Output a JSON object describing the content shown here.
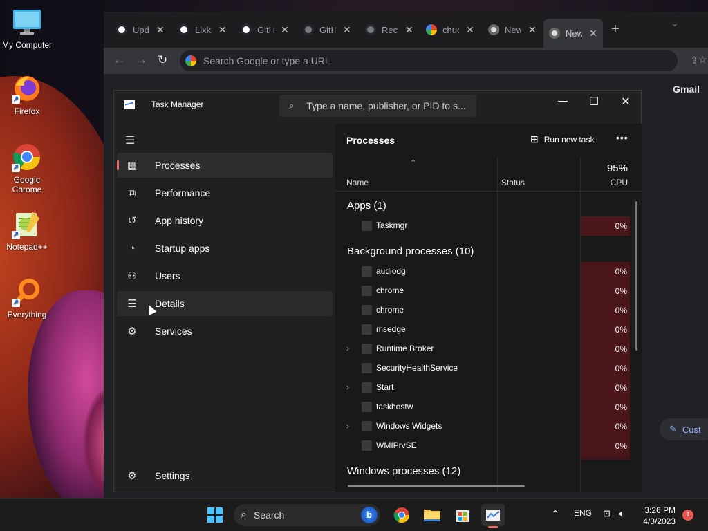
{
  "desktop": {
    "icons": [
      {
        "label": "My Computer",
        "icon": "monitor-icon"
      },
      {
        "label": "Firefox",
        "icon": "firefox-icon"
      },
      {
        "label": "Google Chrome",
        "icon": "chrome-icon"
      },
      {
        "label": "Notepad++",
        "icon": "notepadpp-icon"
      },
      {
        "label": "Everything",
        "icon": "everything-icon"
      }
    ]
  },
  "browser": {
    "tabs": [
      {
        "title": "Upd",
        "icon": "github-icon"
      },
      {
        "title": "Lixk",
        "icon": "github-icon"
      },
      {
        "title": "GitH",
        "icon": "github-icon"
      },
      {
        "title": "GitH",
        "icon": "github-icon"
      },
      {
        "title": "Rect",
        "icon": "github-icon"
      },
      {
        "title": "chuc",
        "icon": "google-icon"
      },
      {
        "title": "New",
        "icon": "chrome-icon"
      },
      {
        "title": "New",
        "icon": "chrome-icon"
      }
    ],
    "omnibox_placeholder": "Search Google or type a URL",
    "gmail_link": "Gmail",
    "customize_label": "Cust"
  },
  "task_manager": {
    "title": "Task Manager",
    "search_placeholder": "Type a name, publisher, or PID to s...",
    "nav": [
      {
        "label": "Processes",
        "icon": "processes-icon"
      },
      {
        "label": "Performance",
        "icon": "performance-icon"
      },
      {
        "label": "App history",
        "icon": "history-icon"
      },
      {
        "label": "Startup apps",
        "icon": "startup-icon"
      },
      {
        "label": "Users",
        "icon": "users-icon"
      },
      {
        "label": "Details",
        "icon": "list-icon"
      },
      {
        "label": "Services",
        "icon": "services-icon"
      }
    ],
    "settings_label": "Settings",
    "page_title": "Processes",
    "run_new_task": "Run new task",
    "columns": {
      "name": "Name",
      "status": "Status",
      "cpu_label": "CPU",
      "cpu_total": "95%"
    },
    "groups": {
      "apps": "Apps (1)",
      "background": "Background processes (10)",
      "windows": "Windows processes (12)"
    },
    "apps": [
      {
        "name": "Taskmgr",
        "cpu": "0%",
        "expandable": false
      }
    ],
    "background": [
      {
        "name": "audiodg",
        "cpu": "0%",
        "expandable": false
      },
      {
        "name": "chrome",
        "cpu": "0%",
        "expandable": false
      },
      {
        "name": "chrome",
        "cpu": "0%",
        "expandable": false
      },
      {
        "name": "msedge",
        "cpu": "0%",
        "expandable": false
      },
      {
        "name": "Runtime Broker",
        "cpu": "0%",
        "expandable": true
      },
      {
        "name": "SecurityHealthService",
        "cpu": "0%",
        "expandable": false
      },
      {
        "name": "Start",
        "cpu": "0%",
        "expandable": true
      },
      {
        "name": "taskhostw",
        "cpu": "0%",
        "expandable": false
      },
      {
        "name": "Windows Widgets",
        "cpu": "0%",
        "expandable": true
      },
      {
        "name": "WMIPrvSE",
        "cpu": "0%",
        "expandable": false
      }
    ]
  },
  "taskbar": {
    "search_label": "Search",
    "language": "ENG",
    "time": "3:26 PM",
    "date": "4/3/2023",
    "notification_count": "1"
  },
  "colors": {
    "accent": "#e8706c",
    "cpu_cell": "#4a1619",
    "start": "#4cc2ff"
  }
}
